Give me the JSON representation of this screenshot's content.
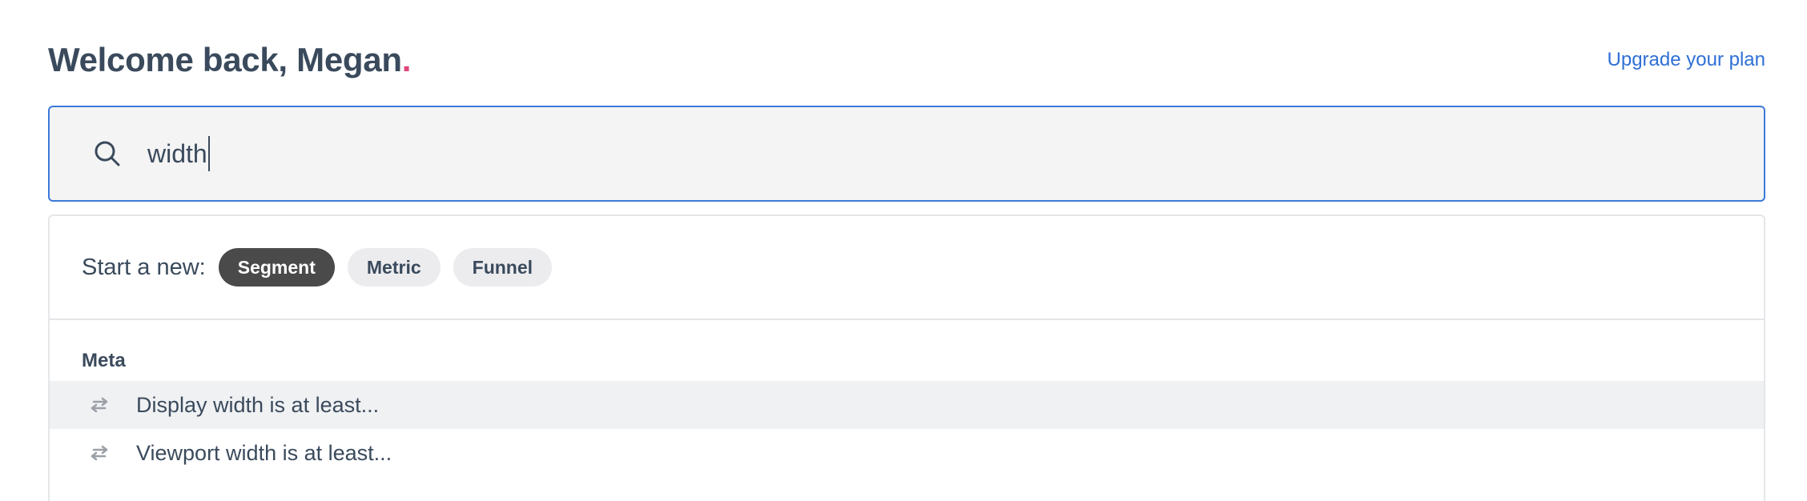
{
  "header": {
    "greeting": "Welcome back, Megan",
    "greeting_punctuation": ".",
    "upgrade_link": "Upgrade your plan"
  },
  "search": {
    "icon": "search-icon",
    "value": "width"
  },
  "dropdown": {
    "start_new": {
      "label": "Start a new:",
      "options": [
        {
          "label": "Segment",
          "active": true
        },
        {
          "label": "Metric",
          "active": false
        },
        {
          "label": "Funnel",
          "active": false
        }
      ]
    },
    "sections": [
      {
        "title": "Meta",
        "items": [
          {
            "icon": "swap-arrows-icon",
            "label": "Display width is at least..."
          },
          {
            "icon": "swap-arrows-icon",
            "label": "Viewport width is at least..."
          }
        ]
      }
    ]
  },
  "colors": {
    "accent_blue": "#3b7ad9",
    "link_blue": "#2f6fd6",
    "dot_pink": "#e0457b",
    "pill_active": "#4a4a4a",
    "pill_inactive": "#ececef"
  }
}
